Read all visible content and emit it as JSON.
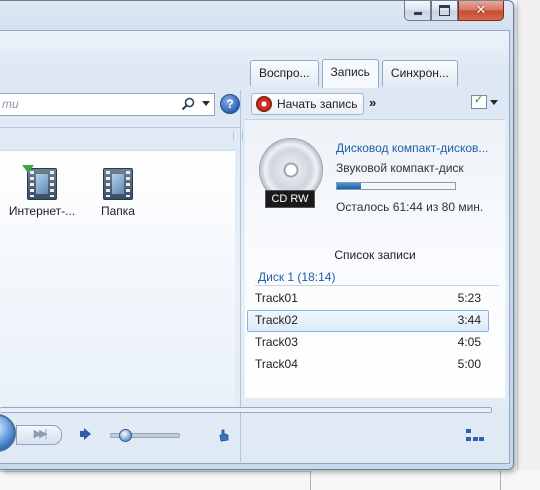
{
  "titlebar": {
    "minimize_icon": "minimize-icon",
    "maximize_icon": "maximize-icon",
    "close_glyph": "✕"
  },
  "tabs": [
    {
      "label": "Воспро...",
      "active": false
    },
    {
      "label": "Запись",
      "active": true
    },
    {
      "label": "Синхрон...",
      "active": false
    }
  ],
  "search": {
    "placeholder": "ти",
    "help_glyph": "?"
  },
  "library": {
    "items": [
      {
        "label": "Интернет-...",
        "icon": "internet-video-icon"
      },
      {
        "label": "Папка",
        "icon": "folder-video-icon"
      }
    ]
  },
  "burn_toolbar": {
    "start_burn_label": "Начать запись",
    "more_glyph": "»"
  },
  "burn": {
    "drive_name": "Дисковод компакт-дисков...",
    "disc_type": "Звуковой компакт-диск",
    "disc_label": "CD RW",
    "progress_fraction": 0.2,
    "remaining": "Осталось 61:44 из 80 мин.",
    "list_heading": "Список записи",
    "disc_group": "Диск 1 (18:14)",
    "tracks": [
      {
        "name": "Track01",
        "length": "5:23",
        "selected": false
      },
      {
        "name": "Track02",
        "length": "3:44",
        "selected": true
      },
      {
        "name": "Track03",
        "length": "4:05",
        "selected": false
      },
      {
        "name": "Track04",
        "length": "5:00",
        "selected": false
      }
    ]
  },
  "player": {
    "next_glyph": "▶▶|",
    "volume_fraction": 0.2
  },
  "colors": {
    "accent": "#1f5ea8",
    "progress": "#1d5fae"
  }
}
